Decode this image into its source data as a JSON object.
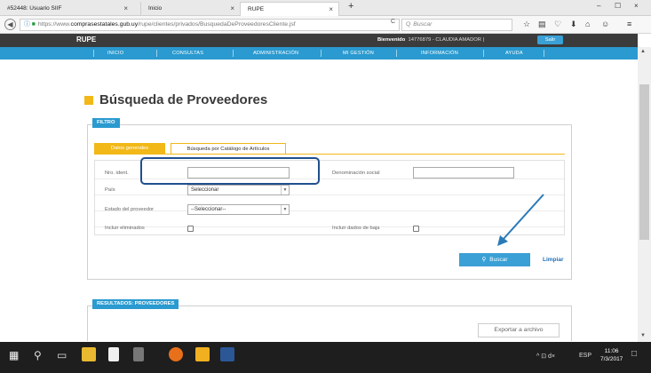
{
  "browser": {
    "tabs": [
      {
        "label": "#52448: Usuario SIIF",
        "close": "×"
      },
      {
        "label": "Inicio",
        "close": "×"
      },
      {
        "label": "RUPE",
        "close": "×"
      }
    ],
    "new_tab": "+",
    "window_controls": {
      "minimize": "–",
      "maximize": "☐",
      "close": "×"
    },
    "url_scheme": "https://www.",
    "url_domain": "comprasestatales.gub.uy",
    "url_path": "/rupe/clientes/privados/BusquedaDeProveedoresCliente.jsf",
    "search_placeholder": "Buscar",
    "icons": {
      "back": "◀",
      "info": "ⓘ",
      "lock": "🔒",
      "reload": "C",
      "search": "Q",
      "star": "☆",
      "reader": "▤",
      "pocket": "♡",
      "download": "⬇",
      "home": "⌂",
      "emoji": "☺",
      "menu": "≡"
    }
  },
  "header": {
    "logo": "RUPE",
    "welcome_label": "Bienvenido",
    "welcome_user": "14776879 - CLAUDIA AMADOR |",
    "logout_label": "Salir"
  },
  "menu": {
    "items": [
      "INICIO",
      "CONSULTAS",
      "ADMINISTRACIÓN",
      "MI GESTIÓN",
      "INFORMACIÓN",
      "AYUDA"
    ]
  },
  "page": {
    "title": "Búsqueda de Proveedores",
    "filter_badge": "FILTRO",
    "tabs": {
      "active": "Datos generales",
      "inactive": "Búsqueda por Catálogo de Artículos"
    },
    "form": {
      "nro_ident_label": "Nro. ident.",
      "nro_ident_value": "",
      "denominacion_label": "Denominación social",
      "denominacion_value": "",
      "pais_label": "País",
      "pais_value": "Seleccionar",
      "estado_label": "Estado del proveedor",
      "estado_value": "--Seleccionar--",
      "eliminados_label": "Incluir eliminados",
      "baja_label": "Incluir dados de baja"
    },
    "search_button": "Buscar",
    "clear_link": "Limpiar",
    "results_badge": "RESULTADOS: PROVEEDORES",
    "export_button": "Exportar a archivo"
  },
  "taskbar": {
    "lang": "ESP",
    "time": "11:06",
    "date": "7/3/2017",
    "tray_icons": "^ ⊡ d×"
  },
  "colors": {
    "accent_blue": "#2a9ad0",
    "accent_yellow": "#f2b818",
    "highlight": "#1f4f8f",
    "annotation_arrow": "#2a7ab8"
  }
}
